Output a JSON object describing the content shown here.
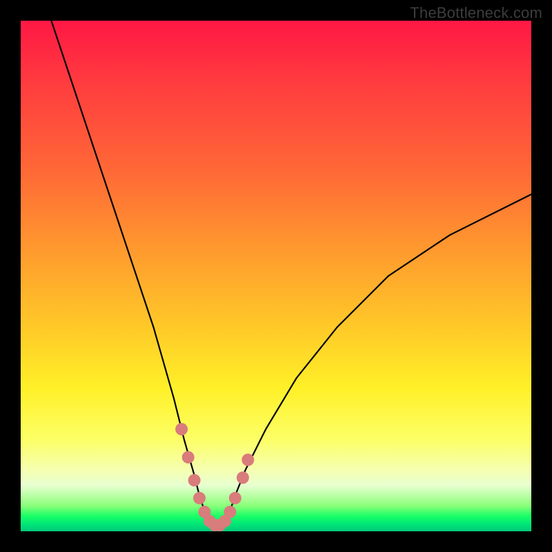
{
  "watermark": "TheBottleneck.com",
  "colors": {
    "frame": "#000000",
    "curve": "#000000",
    "marker": "#d97c7c",
    "gradient_top": "#ff1844",
    "gradient_bottom": "#00c97a"
  },
  "chart_data": {
    "type": "line",
    "title": "",
    "xlabel": "",
    "ylabel": "",
    "xlim": [
      0,
      100
    ],
    "ylim": [
      0,
      100
    ],
    "grid": false,
    "legend": false,
    "series": [
      {
        "name": "bottleneck-curve",
        "x": [
          6,
          10,
          14,
          18,
          22,
          26,
          30,
          32,
          34,
          35,
          36,
          37,
          38,
          39,
          40,
          41,
          42,
          44,
          48,
          54,
          62,
          72,
          84,
          100
        ],
        "values": [
          100,
          88,
          76,
          64,
          52,
          40,
          26,
          18,
          11,
          7,
          4,
          2,
          1,
          1,
          2,
          4,
          7,
          12,
          20,
          30,
          40,
          50,
          58,
          66
        ]
      }
    ],
    "markers": {
      "name": "highlight-dots",
      "color": "#d97c7c",
      "x": [
        31.5,
        32.8,
        34.0,
        35.0,
        36.0,
        37.0,
        38.0,
        39.0,
        40.0,
        41.0,
        42.0,
        43.5,
        44.5
      ],
      "values": [
        20.0,
        14.5,
        10.0,
        6.5,
        3.8,
        2.0,
        1.2,
        1.2,
        2.0,
        3.8,
        6.5,
        10.5,
        14.0
      ]
    }
  }
}
